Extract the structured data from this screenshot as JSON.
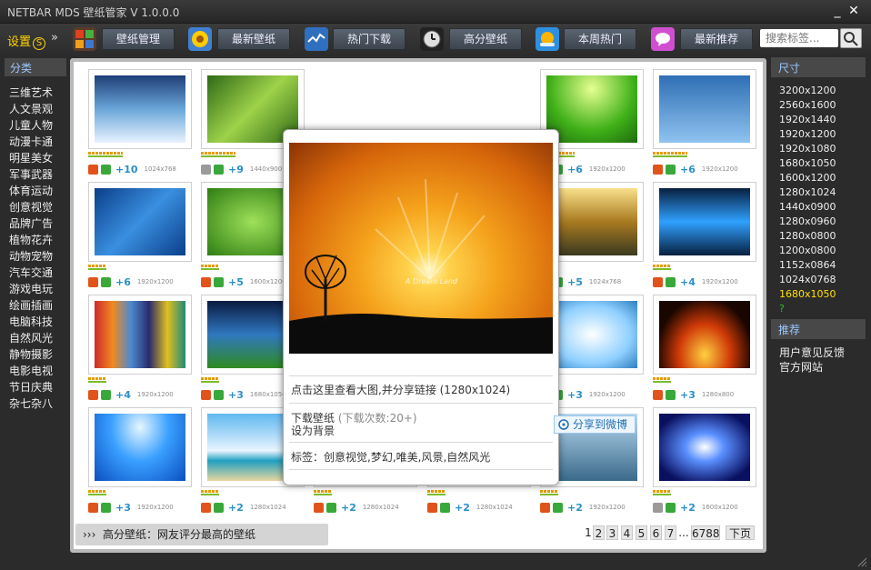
{
  "app": {
    "title": "NETBAR MDS 壁纸管家 V 1.0.0.0",
    "minimize": "_",
    "close": "✕"
  },
  "toolbar": {
    "settings_label": "设置",
    "settings_coin": "S",
    "more": "»",
    "buttons": [
      "壁纸管理",
      "最新壁纸",
      "热门下载",
      "高分壁纸",
      "本周热门",
      "最新推荐"
    ],
    "search_placeholder": "搜索标签..."
  },
  "sidebar": {
    "heading": "分类",
    "categories": [
      "三维艺术",
      "人文景观",
      "儿童人物",
      "动漫卡通",
      "明星美女",
      "军事武器",
      "体育运动",
      "创意视觉",
      "品牌广告",
      "植物花卉",
      "动物宠物",
      "汽车交通",
      "游戏电玩",
      "绘画插画",
      "电脑科技",
      "自然风光",
      "静物摄影",
      "电影电视",
      "节日庆典",
      "杂七杂八"
    ]
  },
  "gallery": {
    "rows": [
      [
        {
          "score": "+10",
          "res": "1024x768"
        },
        {
          "score": "+9",
          "res": "1440x900"
        },
        {
          "score": "",
          "res": ""
        },
        {
          "score": "",
          "res": ""
        },
        {
          "score": "+6",
          "res": "1920x1200"
        },
        {
          "score": "+6",
          "res": "1920x1200"
        }
      ],
      [
        {
          "score": "+6",
          "res": "1920x1200"
        },
        {
          "score": "+5",
          "res": "1600x1200"
        },
        {
          "score": "",
          "res": ""
        },
        {
          "score": "",
          "res": ""
        },
        {
          "score": "+5",
          "res": "1024x768"
        },
        {
          "score": "+4",
          "res": "1920x1200"
        }
      ],
      [
        {
          "score": "+4",
          "res": "1920x1200"
        },
        {
          "score": "+3",
          "res": "1680x1050"
        },
        {
          "score": "",
          "res": ""
        },
        {
          "score": "",
          "res": ""
        },
        {
          "score": "+3",
          "res": "1920x1200"
        },
        {
          "score": "+3",
          "res": "1280x800"
        }
      ],
      [
        {
          "score": "+3",
          "res": "1920x1200"
        },
        {
          "score": "+2",
          "res": "1280x1024"
        },
        {
          "score": "+2",
          "res": "1280x1024"
        },
        {
          "score": "+2",
          "res": "1280x1024"
        },
        {
          "score": "+2",
          "res": "1920x1200"
        },
        {
          "score": "+2",
          "res": "1600x1200"
        }
      ]
    ]
  },
  "popup": {
    "view_link": "点击这里查看大图,并分享链接 (1280x1024)",
    "download": "下载壁纸",
    "download_count": "(下载次数:20+)",
    "set_background": "设为背景",
    "tags": "标签：创意视觉,梦幻,唯美,风景,自然风光",
    "share": "分享到微博",
    "image_caption": "A Dream Land"
  },
  "status": {
    "prefix": "›››",
    "text": "高分壁纸：网友评分最高的壁纸"
  },
  "pager": {
    "pages": [
      "1",
      "2",
      "3",
      "4",
      "5",
      "6",
      "7"
    ],
    "ellipsis": "...",
    "last": "6788",
    "next": "下页"
  },
  "right_panel": {
    "size_heading": "尺寸",
    "sizes": [
      "3200x1200",
      "2560x1600",
      "1920x1440",
      "1920x1200",
      "1920x1080",
      "1680x1050",
      "1600x1200",
      "1280x1024",
      "1440x0900",
      "1280x0960",
      "1280x0800",
      "1200x0800",
      "1152x0864",
      "1024x0768",
      "1680x1050"
    ],
    "selected_size": "1680x1050",
    "help": "?",
    "recommend_heading": "推荐",
    "links": [
      "用户意见反馈",
      "官方网站"
    ]
  }
}
